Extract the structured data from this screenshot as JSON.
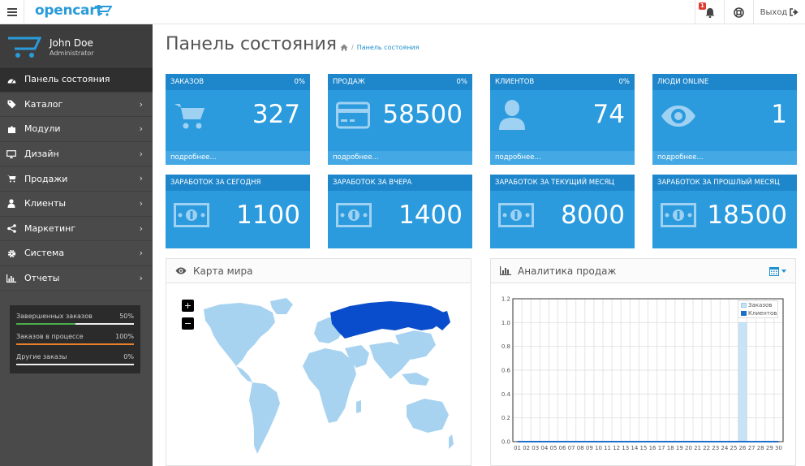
{
  "header": {
    "logo_text": "opencart",
    "notification_count": "1",
    "logout_label": "Выход"
  },
  "sidebar": {
    "user_name": "John Doe",
    "user_role": "Administrator",
    "items": [
      {
        "label": "Панель состояния",
        "icon": "dashboard-icon",
        "active": true
      },
      {
        "label": "Каталог",
        "icon": "tag-icon"
      },
      {
        "label": "Модули",
        "icon": "puzzle-icon"
      },
      {
        "label": "Дизайн",
        "icon": "desktop-icon"
      },
      {
        "label": "Продажи",
        "icon": "cart-icon"
      },
      {
        "label": "Клиенты",
        "icon": "user-icon"
      },
      {
        "label": "Маркетинг",
        "icon": "share-icon"
      },
      {
        "label": "Система",
        "icon": "gear-icon"
      },
      {
        "label": "Отчеты",
        "icon": "bar-chart-icon"
      }
    ],
    "stats": [
      {
        "label": "Завершенных заказов",
        "value": "50%",
        "percent": 50,
        "color": "#4cae4c"
      },
      {
        "label": "Заказов в процессе",
        "value": "100%",
        "percent": 100,
        "color": "#e8802d"
      },
      {
        "label": "Другие заказы",
        "value": "0%",
        "percent": 0,
        "color": "#888888"
      }
    ]
  },
  "page": {
    "title": "Панель состояния",
    "breadcrumb": "Панель состояния"
  },
  "tiles_top": [
    {
      "title": "ЗАКАЗОВ",
      "percent": "0%",
      "value": "327",
      "footer": "подробнее...",
      "icon": "cart-icon"
    },
    {
      "title": "ПРОДАЖ",
      "percent": "0%",
      "value": "58500",
      "footer": "подробнее...",
      "icon": "credit-card-icon"
    },
    {
      "title": "КЛИЕНТОВ",
      "percent": "0%",
      "value": "74",
      "footer": "подробнее...",
      "icon": "user-icon"
    },
    {
      "title": "ЛЮДИ ONLINE",
      "percent": "",
      "value": "1",
      "footer": "подробнее...",
      "icon": "eye-icon"
    }
  ],
  "tiles_bottom": [
    {
      "title": "ЗАРАБОТОК ЗА СЕГОДНЯ",
      "value": "1100",
      "icon": "money-icon"
    },
    {
      "title": "ЗАРАБОТОК ЗА ВЧЕРА",
      "value": "1400",
      "icon": "money-icon"
    },
    {
      "title": "ЗАРАБОТОК ЗА ТЕКУЩИЙ МЕСЯЦ",
      "value": "8000",
      "icon": "money-icon"
    },
    {
      "title": "ЗАРАБОТОК ЗА ПРОШЛЫЙ МЕСЯЦ",
      "value": "18500",
      "icon": "money-icon"
    }
  ],
  "map_panel": {
    "title": "Карта мира",
    "zoom_in": "+",
    "zoom_out": "−"
  },
  "chart_panel": {
    "title": "Аналитика продаж"
  },
  "chart_data": {
    "type": "bar",
    "categories": [
      "01",
      "02",
      "03",
      "04",
      "05",
      "06",
      "07",
      "08",
      "09",
      "10",
      "11",
      "12",
      "13",
      "14",
      "15",
      "16",
      "17",
      "18",
      "19",
      "20",
      "21",
      "22",
      "23",
      "24",
      "25",
      "26",
      "27",
      "28",
      "29",
      "30"
    ],
    "series": [
      {
        "name": "Заказов",
        "color": "#c7e3f7",
        "values": [
          0,
          0,
          0,
          0,
          0,
          0,
          0,
          0,
          0,
          0,
          0,
          0,
          0,
          0,
          0,
          0,
          0,
          0,
          0,
          0,
          0,
          0,
          0,
          0,
          0,
          1,
          0,
          0,
          0,
          0
        ]
      },
      {
        "name": "Клиентов",
        "color": "#1e6fc9",
        "values": [
          0,
          0,
          0,
          0,
          0,
          0,
          0,
          0,
          0,
          0,
          0,
          0,
          0,
          0,
          0,
          0,
          0,
          0,
          0,
          0,
          0,
          0,
          0,
          0,
          0,
          0,
          0,
          0,
          0,
          0
        ]
      }
    ],
    "yticks": [
      "0.0",
      "0.2",
      "0.4",
      "0.6",
      "0.8",
      "1.0",
      "1.2"
    ],
    "ylim": [
      0,
      1.2
    ],
    "grid": true,
    "legend": "top-right"
  }
}
